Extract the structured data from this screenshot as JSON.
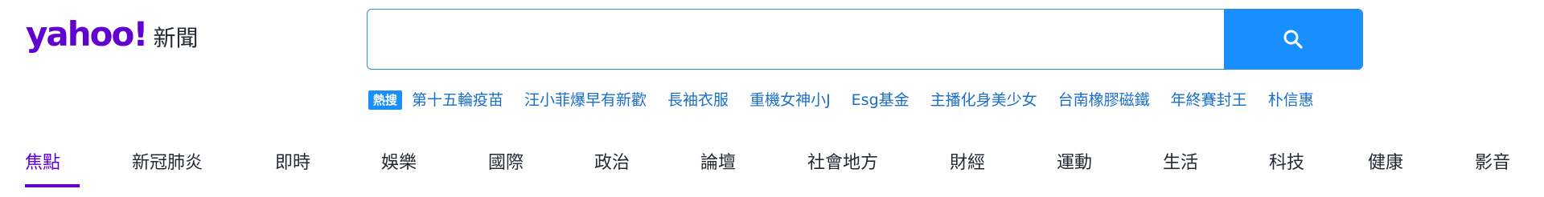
{
  "logo": {
    "text": "yahoo!",
    "sub": "新聞"
  },
  "search": {
    "placeholder": "",
    "value": ""
  },
  "trending": {
    "badge": "熱搜",
    "items": [
      "第十五輪疫苗",
      "汪小菲爆早有新歡",
      "長袖衣服",
      "重機女神小J",
      "Esg基金",
      "主播化身美少女",
      "台南橡膠磁鐵",
      "年終賽封王",
      "朴信惠"
    ]
  },
  "nav": {
    "active_index": 0,
    "items": [
      "焦點",
      "新冠肺炎",
      "即時",
      "娛樂",
      "國際",
      "政治",
      "論壇",
      "社會地方",
      "財經",
      "運動",
      "生活",
      "科技",
      "健康",
      "影音"
    ]
  },
  "colors": {
    "brand_purple": "#6001d2",
    "search_blue": "#188fff",
    "link_blue": "#1a6ec9",
    "text_dark": "#232a31"
  }
}
